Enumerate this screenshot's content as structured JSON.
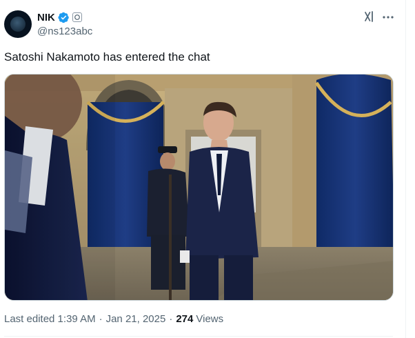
{
  "post": {
    "author": {
      "display_name": "NIK",
      "handle": "@ns123abc",
      "verified": true,
      "verified_color": "#1d9bf0",
      "affiliation_badge": "square-badge-icon"
    },
    "text": "Satoshi Nakamoto has entered the chat",
    "header_icons": [
      "grok-icon",
      "more-horizontal-icon"
    ],
    "media": {
      "type": "photo",
      "icon": "photo"
    },
    "meta": {
      "edited_time": "Last edited 1:39 AM",
      "separator": "·",
      "date": "Jan 21, 2025",
      "views_count": "274",
      "views_label": "Views"
    }
  },
  "colors": {
    "text_primary": "#0f1419",
    "text_secondary": "#536471",
    "border": "#cfd9de",
    "accent": "#1d9bf0"
  }
}
